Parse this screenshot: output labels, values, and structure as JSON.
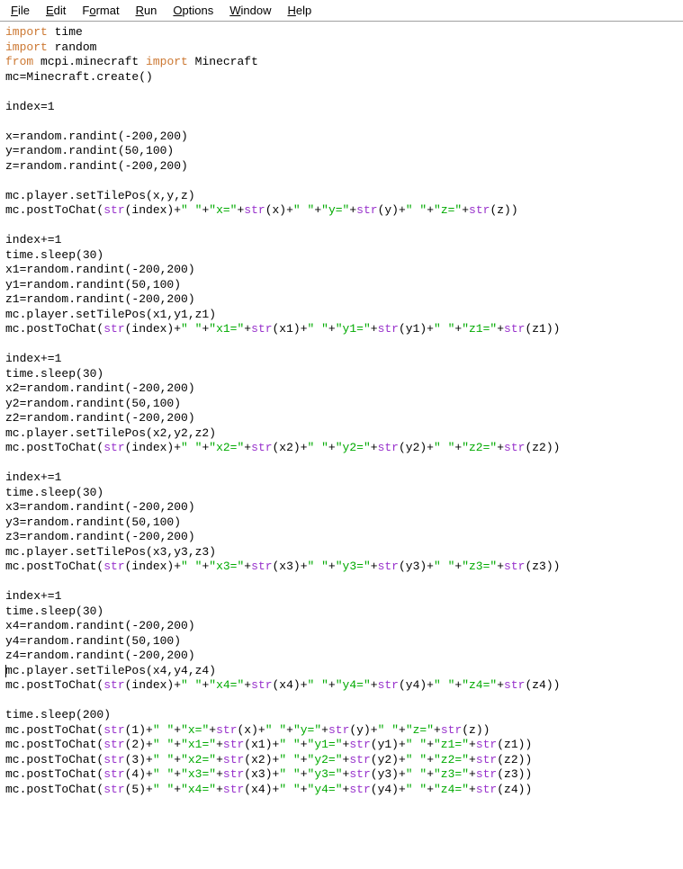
{
  "menubar": {
    "items": [
      {
        "label": "File",
        "underline": 0
      },
      {
        "label": "Edit",
        "underline": 0
      },
      {
        "label": "Format",
        "underline": 1
      },
      {
        "label": "Run",
        "underline": 0
      },
      {
        "label": "Options",
        "underline": 0
      },
      {
        "label": "Window",
        "underline": 0
      },
      {
        "label": "Help",
        "underline": 0
      }
    ]
  },
  "code": {
    "lines": [
      [
        {
          "t": "kw",
          "v": "import"
        },
        {
          "t": "plain",
          "v": " time"
        }
      ],
      [
        {
          "t": "kw",
          "v": "import"
        },
        {
          "t": "plain",
          "v": " random"
        }
      ],
      [
        {
          "t": "kw",
          "v": "from"
        },
        {
          "t": "plain",
          "v": " mcpi.minecraft "
        },
        {
          "t": "kw",
          "v": "import"
        },
        {
          "t": "plain",
          "v": " Minecraft"
        }
      ],
      [
        {
          "t": "plain",
          "v": "mc=Minecraft.create()"
        }
      ],
      [],
      [
        {
          "t": "plain",
          "v": "index=1"
        }
      ],
      [],
      [
        {
          "t": "plain",
          "v": "x=random.randint(-200,200)"
        }
      ],
      [
        {
          "t": "plain",
          "v": "y=random.randint(50,100)"
        }
      ],
      [
        {
          "t": "plain",
          "v": "z=random.randint(-200,200)"
        }
      ],
      [],
      [
        {
          "t": "plain",
          "v": "mc.player.setTilePos(x,y,z)"
        }
      ],
      [
        {
          "t": "plain",
          "v": "mc.postToChat("
        },
        {
          "t": "fn",
          "v": "str"
        },
        {
          "t": "plain",
          "v": "(index)+"
        },
        {
          "t": "str",
          "v": "\" \""
        },
        {
          "t": "plain",
          "v": "+"
        },
        {
          "t": "str",
          "v": "\"x=\""
        },
        {
          "t": "plain",
          "v": "+"
        },
        {
          "t": "fn",
          "v": "str"
        },
        {
          "t": "plain",
          "v": "(x)+"
        },
        {
          "t": "str",
          "v": "\" \""
        },
        {
          "t": "plain",
          "v": "+"
        },
        {
          "t": "str",
          "v": "\"y=\""
        },
        {
          "t": "plain",
          "v": "+"
        },
        {
          "t": "fn",
          "v": "str"
        },
        {
          "t": "plain",
          "v": "(y)+"
        },
        {
          "t": "str",
          "v": "\" \""
        },
        {
          "t": "plain",
          "v": "+"
        },
        {
          "t": "str",
          "v": "\"z=\""
        },
        {
          "t": "plain",
          "v": "+"
        },
        {
          "t": "fn",
          "v": "str"
        },
        {
          "t": "plain",
          "v": "(z))"
        }
      ],
      [],
      [
        {
          "t": "plain",
          "v": "index+=1"
        }
      ],
      [
        {
          "t": "plain",
          "v": "time.sleep(30)"
        }
      ],
      [
        {
          "t": "plain",
          "v": "x1=random.randint(-200,200)"
        }
      ],
      [
        {
          "t": "plain",
          "v": "y1=random.randint(50,100)"
        }
      ],
      [
        {
          "t": "plain",
          "v": "z1=random.randint(-200,200)"
        }
      ],
      [
        {
          "t": "plain",
          "v": "mc.player.setTilePos(x1,y1,z1)"
        }
      ],
      [
        {
          "t": "plain",
          "v": "mc.postToChat("
        },
        {
          "t": "fn",
          "v": "str"
        },
        {
          "t": "plain",
          "v": "(index)+"
        },
        {
          "t": "str",
          "v": "\" \""
        },
        {
          "t": "plain",
          "v": "+"
        },
        {
          "t": "str",
          "v": "\"x1=\""
        },
        {
          "t": "plain",
          "v": "+"
        },
        {
          "t": "fn",
          "v": "str"
        },
        {
          "t": "plain",
          "v": "(x1)+"
        },
        {
          "t": "str",
          "v": "\" \""
        },
        {
          "t": "plain",
          "v": "+"
        },
        {
          "t": "str",
          "v": "\"y1=\""
        },
        {
          "t": "plain",
          "v": "+"
        },
        {
          "t": "fn",
          "v": "str"
        },
        {
          "t": "plain",
          "v": "(y1)+"
        },
        {
          "t": "str",
          "v": "\" \""
        },
        {
          "t": "plain",
          "v": "+"
        },
        {
          "t": "str",
          "v": "\"z1=\""
        },
        {
          "t": "plain",
          "v": "+"
        },
        {
          "t": "fn",
          "v": "str"
        },
        {
          "t": "plain",
          "v": "(z1))"
        }
      ],
      [],
      [
        {
          "t": "plain",
          "v": "index+=1"
        }
      ],
      [
        {
          "t": "plain",
          "v": "time.sleep(30)"
        }
      ],
      [
        {
          "t": "plain",
          "v": "x2=random.randint(-200,200)"
        }
      ],
      [
        {
          "t": "plain",
          "v": "y2=random.randint(50,100)"
        }
      ],
      [
        {
          "t": "plain",
          "v": "z2=random.randint(-200,200)"
        }
      ],
      [
        {
          "t": "plain",
          "v": "mc.player.setTilePos(x2,y2,z2)"
        }
      ],
      [
        {
          "t": "plain",
          "v": "mc.postToChat("
        },
        {
          "t": "fn",
          "v": "str"
        },
        {
          "t": "plain",
          "v": "(index)+"
        },
        {
          "t": "str",
          "v": "\" \""
        },
        {
          "t": "plain",
          "v": "+"
        },
        {
          "t": "str",
          "v": "\"x2=\""
        },
        {
          "t": "plain",
          "v": "+"
        },
        {
          "t": "fn",
          "v": "str"
        },
        {
          "t": "plain",
          "v": "(x2)+"
        },
        {
          "t": "str",
          "v": "\" \""
        },
        {
          "t": "plain",
          "v": "+"
        },
        {
          "t": "str",
          "v": "\"y2=\""
        },
        {
          "t": "plain",
          "v": "+"
        },
        {
          "t": "fn",
          "v": "str"
        },
        {
          "t": "plain",
          "v": "(y2)+"
        },
        {
          "t": "str",
          "v": "\" \""
        },
        {
          "t": "plain",
          "v": "+"
        },
        {
          "t": "str",
          "v": "\"z2=\""
        },
        {
          "t": "plain",
          "v": "+"
        },
        {
          "t": "fn",
          "v": "str"
        },
        {
          "t": "plain",
          "v": "(z2))"
        }
      ],
      [],
      [
        {
          "t": "plain",
          "v": "index+=1"
        }
      ],
      [
        {
          "t": "plain",
          "v": "time.sleep(30)"
        }
      ],
      [
        {
          "t": "plain",
          "v": "x3=random.randint(-200,200)"
        }
      ],
      [
        {
          "t": "plain",
          "v": "y3=random.randint(50,100)"
        }
      ],
      [
        {
          "t": "plain",
          "v": "z3=random.randint(-200,200)"
        }
      ],
      [
        {
          "t": "plain",
          "v": "mc.player.setTilePos(x3,y3,z3)"
        }
      ],
      [
        {
          "t": "plain",
          "v": "mc.postToChat("
        },
        {
          "t": "fn",
          "v": "str"
        },
        {
          "t": "plain",
          "v": "(index)+"
        },
        {
          "t": "str",
          "v": "\" \""
        },
        {
          "t": "plain",
          "v": "+"
        },
        {
          "t": "str",
          "v": "\"x3=\""
        },
        {
          "t": "plain",
          "v": "+"
        },
        {
          "t": "fn",
          "v": "str"
        },
        {
          "t": "plain",
          "v": "(x3)+"
        },
        {
          "t": "str",
          "v": "\" \""
        },
        {
          "t": "plain",
          "v": "+"
        },
        {
          "t": "str",
          "v": "\"y3=\""
        },
        {
          "t": "plain",
          "v": "+"
        },
        {
          "t": "fn",
          "v": "str"
        },
        {
          "t": "plain",
          "v": "(y3)+"
        },
        {
          "t": "str",
          "v": "\" \""
        },
        {
          "t": "plain",
          "v": "+"
        },
        {
          "t": "str",
          "v": "\"z3=\""
        },
        {
          "t": "plain",
          "v": "+"
        },
        {
          "t": "fn",
          "v": "str"
        },
        {
          "t": "plain",
          "v": "(z3))"
        }
      ],
      [],
      [
        {
          "t": "plain",
          "v": "index+=1"
        }
      ],
      [
        {
          "t": "plain",
          "v": "time.sleep(30)"
        }
      ],
      [
        {
          "t": "plain",
          "v": "x4=random.randint(-200,200)"
        }
      ],
      [
        {
          "t": "plain",
          "v": "y4=random.randint(50,100)"
        }
      ],
      [
        {
          "t": "plain",
          "v": "z4=random.randint(-200,200)"
        }
      ],
      [
        {
          "t": "plain",
          "v": "mc.player.setTilePos(x4,y4,z4)"
        }
      ],
      [
        {
          "t": "plain",
          "v": "mc.postToChat("
        },
        {
          "t": "fn",
          "v": "str"
        },
        {
          "t": "plain",
          "v": "(index)+"
        },
        {
          "t": "str",
          "v": "\" \""
        },
        {
          "t": "plain",
          "v": "+"
        },
        {
          "t": "str",
          "v": "\"x4=\""
        },
        {
          "t": "plain",
          "v": "+"
        },
        {
          "t": "fn",
          "v": "str"
        },
        {
          "t": "plain",
          "v": "(x4)+"
        },
        {
          "t": "str",
          "v": "\" \""
        },
        {
          "t": "plain",
          "v": "+"
        },
        {
          "t": "str",
          "v": "\"y4=\""
        },
        {
          "t": "plain",
          "v": "+"
        },
        {
          "t": "fn",
          "v": "str"
        },
        {
          "t": "plain",
          "v": "(y4)+"
        },
        {
          "t": "str",
          "v": "\" \""
        },
        {
          "t": "plain",
          "v": "+"
        },
        {
          "t": "str",
          "v": "\"z4=\""
        },
        {
          "t": "plain",
          "v": "+"
        },
        {
          "t": "fn",
          "v": "str"
        },
        {
          "t": "plain",
          "v": "(z4))"
        }
      ],
      [],
      [
        {
          "t": "plain",
          "v": "time.sleep(200)"
        }
      ],
      [
        {
          "t": "plain",
          "v": "mc.postToChat("
        },
        {
          "t": "fn",
          "v": "str"
        },
        {
          "t": "plain",
          "v": "(1)+"
        },
        {
          "t": "str",
          "v": "\" \""
        },
        {
          "t": "plain",
          "v": "+"
        },
        {
          "t": "str",
          "v": "\"x=\""
        },
        {
          "t": "plain",
          "v": "+"
        },
        {
          "t": "fn",
          "v": "str"
        },
        {
          "t": "plain",
          "v": "(x)+"
        },
        {
          "t": "str",
          "v": "\" \""
        },
        {
          "t": "plain",
          "v": "+"
        },
        {
          "t": "str",
          "v": "\"y=\""
        },
        {
          "t": "plain",
          "v": "+"
        },
        {
          "t": "fn",
          "v": "str"
        },
        {
          "t": "plain",
          "v": "(y)+"
        },
        {
          "t": "str",
          "v": "\" \""
        },
        {
          "t": "plain",
          "v": "+"
        },
        {
          "t": "str",
          "v": "\"z=\""
        },
        {
          "t": "plain",
          "v": "+"
        },
        {
          "t": "fn",
          "v": "str"
        },
        {
          "t": "plain",
          "v": "(z))"
        }
      ],
      [
        {
          "t": "plain",
          "v": "mc.postToChat("
        },
        {
          "t": "fn",
          "v": "str"
        },
        {
          "t": "plain",
          "v": "(2)+"
        },
        {
          "t": "str",
          "v": "\" \""
        },
        {
          "t": "plain",
          "v": "+"
        },
        {
          "t": "str",
          "v": "\"x1=\""
        },
        {
          "t": "plain",
          "v": "+"
        },
        {
          "t": "fn",
          "v": "str"
        },
        {
          "t": "plain",
          "v": "(x1)+"
        },
        {
          "t": "str",
          "v": "\" \""
        },
        {
          "t": "plain",
          "v": "+"
        },
        {
          "t": "str",
          "v": "\"y1=\""
        },
        {
          "t": "plain",
          "v": "+"
        },
        {
          "t": "fn",
          "v": "str"
        },
        {
          "t": "plain",
          "v": "(y1)+"
        },
        {
          "t": "str",
          "v": "\" \""
        },
        {
          "t": "plain",
          "v": "+"
        },
        {
          "t": "str",
          "v": "\"z1=\""
        },
        {
          "t": "plain",
          "v": "+"
        },
        {
          "t": "fn",
          "v": "str"
        },
        {
          "t": "plain",
          "v": "(z1))"
        }
      ],
      [
        {
          "t": "plain",
          "v": "mc.postToChat("
        },
        {
          "t": "fn",
          "v": "str"
        },
        {
          "t": "plain",
          "v": "(3)+"
        },
        {
          "t": "str",
          "v": "\" \""
        },
        {
          "t": "plain",
          "v": "+"
        },
        {
          "t": "str",
          "v": "\"x2=\""
        },
        {
          "t": "plain",
          "v": "+"
        },
        {
          "t": "fn",
          "v": "str"
        },
        {
          "t": "plain",
          "v": "(x2)+"
        },
        {
          "t": "str",
          "v": "\" \""
        },
        {
          "t": "plain",
          "v": "+"
        },
        {
          "t": "str",
          "v": "\"y2=\""
        },
        {
          "t": "plain",
          "v": "+"
        },
        {
          "t": "fn",
          "v": "str"
        },
        {
          "t": "plain",
          "v": "(y2)+"
        },
        {
          "t": "str",
          "v": "\" \""
        },
        {
          "t": "plain",
          "v": "+"
        },
        {
          "t": "str",
          "v": "\"z2=\""
        },
        {
          "t": "plain",
          "v": "+"
        },
        {
          "t": "fn",
          "v": "str"
        },
        {
          "t": "plain",
          "v": "(z2))"
        }
      ],
      [
        {
          "t": "plain",
          "v": "mc.postToChat("
        },
        {
          "t": "fn",
          "v": "str"
        },
        {
          "t": "plain",
          "v": "(4)+"
        },
        {
          "t": "str",
          "v": "\" \""
        },
        {
          "t": "plain",
          "v": "+"
        },
        {
          "t": "str",
          "v": "\"x3=\""
        },
        {
          "t": "plain",
          "v": "+"
        },
        {
          "t": "fn",
          "v": "str"
        },
        {
          "t": "plain",
          "v": "(x3)+"
        },
        {
          "t": "str",
          "v": "\" \""
        },
        {
          "t": "plain",
          "v": "+"
        },
        {
          "t": "str",
          "v": "\"y3=\""
        },
        {
          "t": "plain",
          "v": "+"
        },
        {
          "t": "fn",
          "v": "str"
        },
        {
          "t": "plain",
          "v": "(y3)+"
        },
        {
          "t": "str",
          "v": "\" \""
        },
        {
          "t": "plain",
          "v": "+"
        },
        {
          "t": "str",
          "v": "\"z3=\""
        },
        {
          "t": "plain",
          "v": "+"
        },
        {
          "t": "fn",
          "v": "str"
        },
        {
          "t": "plain",
          "v": "(z3))"
        }
      ],
      [
        {
          "t": "plain",
          "v": "mc.postToChat("
        },
        {
          "t": "fn",
          "v": "str"
        },
        {
          "t": "plain",
          "v": "(5)+"
        },
        {
          "t": "str",
          "v": "\" \""
        },
        {
          "t": "plain",
          "v": "+"
        },
        {
          "t": "str",
          "v": "\"x4=\""
        },
        {
          "t": "plain",
          "v": "+"
        },
        {
          "t": "fn",
          "v": "str"
        },
        {
          "t": "plain",
          "v": "(x4)+"
        },
        {
          "t": "str",
          "v": "\" \""
        },
        {
          "t": "plain",
          "v": "+"
        },
        {
          "t": "str",
          "v": "\"y4=\""
        },
        {
          "t": "plain",
          "v": "+"
        },
        {
          "t": "fn",
          "v": "str"
        },
        {
          "t": "plain",
          "v": "(y4)+"
        },
        {
          "t": "str",
          "v": "\" \""
        },
        {
          "t": "plain",
          "v": "+"
        },
        {
          "t": "str",
          "v": "\"z4=\""
        },
        {
          "t": "plain",
          "v": "+"
        },
        {
          "t": "fn",
          "v": "str"
        },
        {
          "t": "plain",
          "v": "(z4))"
        }
      ]
    ],
    "cursor_line": 43
  }
}
